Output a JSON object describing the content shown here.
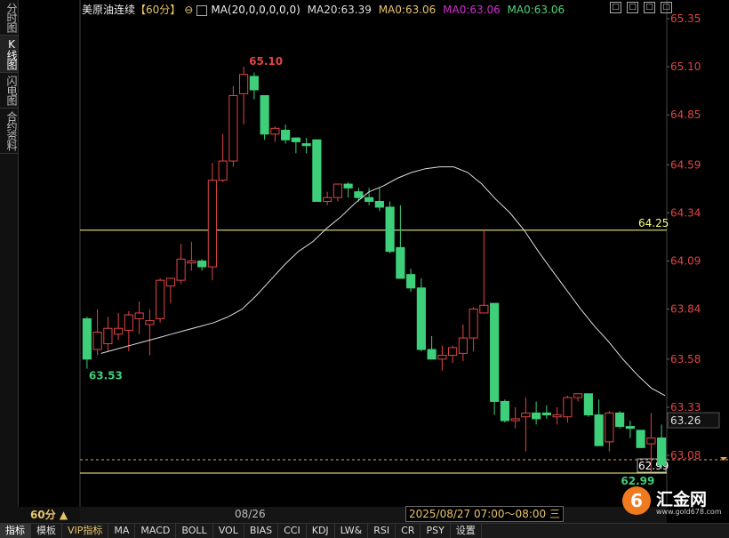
{
  "sidebar": {
    "tabs": [
      "分时图",
      "K线图",
      "闪电图",
      "合约资料"
    ]
  },
  "header": {
    "title": "美原油连续",
    "period_tag": "【60分】",
    "ma_formula": "MA(20,0,0,0,0,0)",
    "ma20": "MA20:63.39",
    "ma_a": "MA0:63.06",
    "ma_b": "MA0:63.06",
    "ma_c": "MA0:63.06",
    "colors": {
      "ma20": "#dddddd",
      "ma_a": "#e8c56a",
      "ma_b": "#d02fd0",
      "ma_c": "#4fd27e"
    }
  },
  "window_controls": [
    "□",
    "□",
    "□",
    "□"
  ],
  "bottom_tabs": [
    "指标",
    "模板",
    "VIP指标",
    "MA",
    "MACD",
    "BOLL",
    "VOL",
    "BIAS",
    "CCI",
    "KDJ",
    "LW&",
    "RSI",
    "CR",
    "PSY",
    "设置"
  ],
  "period_selector": "60分 ▲",
  "date_label": "08/26",
  "crosshair_label": "2025/08/27 07:00～08:00 三",
  "logo": {
    "name": "汇金网",
    "url": "www.gold678.com"
  },
  "chart_data": {
    "type": "candlestick",
    "y_ticks": [
      65.35,
      65.1,
      64.85,
      64.59,
      64.34,
      64.09,
      63.84,
      63.58,
      63.33,
      63.08
    ],
    "y_tick_labels": [
      "65.35",
      "65.10",
      "64.85",
      "64.59",
      "64.34",
      "64.09",
      "63.84",
      "63.58",
      "63.33",
      "63.08"
    ],
    "colors": {
      "up": "#e04545",
      "down": "#3ecf7a",
      "ma20": "#dddddd",
      "hline": "#ffff88",
      "axis_text": "#e04545"
    },
    "candles": [
      {
        "o": 63.79,
        "h": 63.8,
        "l": 63.53,
        "c": 63.58
      },
      {
        "o": 63.63,
        "h": 63.84,
        "l": 63.6,
        "c": 63.72
      },
      {
        "o": 63.66,
        "h": 63.8,
        "l": 63.62,
        "c": 63.74
      },
      {
        "o": 63.71,
        "h": 63.82,
        "l": 63.68,
        "c": 63.74
      },
      {
        "o": 63.73,
        "h": 63.83,
        "l": 63.62,
        "c": 63.81
      },
      {
        "o": 63.79,
        "h": 63.88,
        "l": 63.71,
        "c": 63.82
      },
      {
        "o": 63.76,
        "h": 63.84,
        "l": 63.6,
        "c": 63.78
      },
      {
        "o": 63.79,
        "h": 64.0,
        "l": 63.77,
        "c": 63.99
      },
      {
        "o": 63.96,
        "h": 64.0,
        "l": 63.87,
        "c": 64.0
      },
      {
        "o": 63.99,
        "h": 64.18,
        "l": 63.97,
        "c": 64.1
      },
      {
        "o": 64.08,
        "h": 64.19,
        "l": 64.04,
        "c": 64.09
      },
      {
        "o": 64.09,
        "h": 64.1,
        "l": 64.04,
        "c": 64.06
      },
      {
        "o": 64.06,
        "h": 64.6,
        "l": 63.99,
        "c": 64.51
      },
      {
        "o": 64.51,
        "h": 64.75,
        "l": 64.5,
        "c": 64.61
      },
      {
        "o": 64.61,
        "h": 65.0,
        "l": 64.58,
        "c": 64.95
      },
      {
        "o": 64.96,
        "h": 65.1,
        "l": 64.8,
        "c": 65.06
      },
      {
        "o": 65.05,
        "h": 65.07,
        "l": 64.93,
        "c": 64.98
      },
      {
        "o": 64.95,
        "h": 64.95,
        "l": 64.72,
        "c": 64.75
      },
      {
        "o": 64.75,
        "h": 64.79,
        "l": 64.71,
        "c": 64.78
      },
      {
        "o": 64.77,
        "h": 64.8,
        "l": 64.7,
        "c": 64.72
      },
      {
        "o": 64.73,
        "h": 64.73,
        "l": 64.65,
        "c": 64.71
      },
      {
        "o": 64.7,
        "h": 64.73,
        "l": 64.65,
        "c": 64.69
      },
      {
        "o": 64.72,
        "h": 64.72,
        "l": 64.4,
        "c": 64.4
      },
      {
        "o": 64.4,
        "h": 64.45,
        "l": 64.38,
        "c": 64.42
      },
      {
        "o": 64.42,
        "h": 64.49,
        "l": 64.4,
        "c": 64.49
      },
      {
        "o": 64.49,
        "h": 64.5,
        "l": 64.42,
        "c": 64.47
      },
      {
        "o": 64.45,
        "h": 64.47,
        "l": 64.4,
        "c": 64.42
      },
      {
        "o": 64.42,
        "h": 64.47,
        "l": 64.38,
        "c": 64.4
      },
      {
        "o": 64.4,
        "h": 64.47,
        "l": 64.35,
        "c": 64.37
      },
      {
        "o": 64.37,
        "h": 64.4,
        "l": 64.13,
        "c": 64.14
      },
      {
        "o": 64.16,
        "h": 64.38,
        "l": 64.0,
        "c": 64.0
      },
      {
        "o": 64.02,
        "h": 64.05,
        "l": 63.93,
        "c": 63.95
      },
      {
        "o": 63.95,
        "h": 64.0,
        "l": 63.62,
        "c": 63.63
      },
      {
        "o": 63.63,
        "h": 63.7,
        "l": 63.58,
        "c": 63.58
      },
      {
        "o": 63.58,
        "h": 63.65,
        "l": 63.52,
        "c": 63.6
      },
      {
        "o": 63.6,
        "h": 63.65,
        "l": 63.56,
        "c": 63.64
      },
      {
        "o": 63.61,
        "h": 63.76,
        "l": 63.57,
        "c": 63.69
      },
      {
        "o": 63.69,
        "h": 63.85,
        "l": 63.62,
        "c": 63.84
      },
      {
        "o": 63.82,
        "h": 64.25,
        "l": 63.82,
        "c": 63.86
      },
      {
        "o": 63.87,
        "h": 63.87,
        "l": 63.29,
        "c": 63.36
      },
      {
        "o": 63.36,
        "h": 63.37,
        "l": 63.25,
        "c": 63.26
      },
      {
        "o": 63.26,
        "h": 63.33,
        "l": 63.22,
        "c": 63.27
      },
      {
        "o": 63.28,
        "h": 63.38,
        "l": 63.1,
        "c": 63.3
      },
      {
        "o": 63.3,
        "h": 63.36,
        "l": 63.24,
        "c": 63.27
      },
      {
        "o": 63.3,
        "h": 63.34,
        "l": 63.27,
        "c": 63.29
      },
      {
        "o": 63.28,
        "h": 63.33,
        "l": 63.24,
        "c": 63.29
      },
      {
        "o": 63.28,
        "h": 63.39,
        "l": 63.25,
        "c": 63.38
      },
      {
        "o": 63.38,
        "h": 63.4,
        "l": 63.36,
        "c": 63.4
      },
      {
        "o": 63.4,
        "h": 63.4,
        "l": 63.28,
        "c": 63.29
      },
      {
        "o": 63.29,
        "h": 63.37,
        "l": 63.13,
        "c": 63.13
      },
      {
        "o": 63.15,
        "h": 63.31,
        "l": 63.1,
        "c": 63.3
      },
      {
        "o": 63.3,
        "h": 63.31,
        "l": 63.22,
        "c": 63.23
      },
      {
        "o": 63.23,
        "h": 63.26,
        "l": 63.17,
        "c": 63.22
      },
      {
        "o": 63.21,
        "h": 63.21,
        "l": 63.12,
        "c": 63.12
      },
      {
        "o": 63.14,
        "h": 63.3,
        "l": 62.99,
        "c": 63.17
      },
      {
        "o": 63.17,
        "h": 63.24,
        "l": 63.01,
        "c": 63.03
      }
    ],
    "ma20": [
      63.61,
      63.63,
      63.65,
      63.67,
      63.69,
      63.71,
      63.73,
      63.75,
      63.77,
      63.8,
      63.84,
      63.91,
      63.99,
      64.07,
      64.14,
      64.19,
      64.26,
      64.32,
      64.39,
      64.45,
      64.48,
      64.52,
      64.55,
      64.57,
      64.58,
      64.58,
      64.55,
      64.49,
      64.41,
      64.34,
      64.25,
      64.14,
      64.04,
      63.94,
      63.84,
      63.75,
      63.67,
      63.58,
      63.5,
      63.43,
      63.39
    ],
    "ma20_start_index": 15,
    "horizontal_lines": [
      {
        "value": 64.25,
        "label": "64.25"
      },
      {
        "value": 62.99,
        "label": "62.99"
      }
    ],
    "dashed_line": {
      "value": 63.02,
      "label": "62.99"
    },
    "current_price": "63.26",
    "annotations": {
      "high": "65.10",
      "low": "63.53",
      "last_low": "62.99"
    }
  }
}
